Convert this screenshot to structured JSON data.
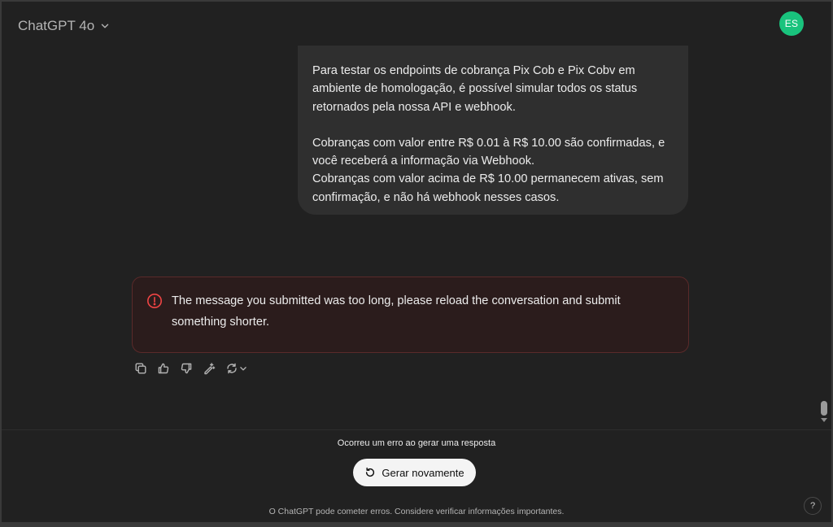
{
  "header": {
    "model_name": "ChatGPT 4o",
    "avatar_initials": "ES"
  },
  "conversation": {
    "user_message": {
      "paragraph1": "Para testar os endpoints de cobrança Pix Cob e Pix Cobv em ambiente de homologação, é possível simular todos os status retornados pela nossa API e webhook.",
      "paragraph2": "Cobranças com valor entre R$ 0.01 à R$ 10.00 são confirmadas, e você receberá a informação via Webhook.",
      "paragraph3": "Cobranças com valor acima de R$ 10.00 permanecem ativas, sem confirmação, e não há webhook nesses casos."
    },
    "error_message": "The message you submitted was too long, please reload the conversation and submit something shorter.",
    "actions": {
      "icons": [
        "copy-icon",
        "thumbs-up-icon",
        "thumbs-down-icon",
        "edit-sparkle-icon",
        "regenerate-icon",
        "chevron-down-icon"
      ]
    }
  },
  "footer": {
    "error_text": "Ocorreu um erro ao gerar uma resposta",
    "regenerate_label": "Gerar novamente",
    "disclaimer": "O ChatGPT pode cometer erros. Considere verificar informações importantes.",
    "help_label": "?"
  },
  "colors": {
    "background": "#212121",
    "bubble": "#2f2f2f",
    "error_bg": "#2b1c1c",
    "error_icon": "#ef4444",
    "avatar": "#19c37d"
  }
}
